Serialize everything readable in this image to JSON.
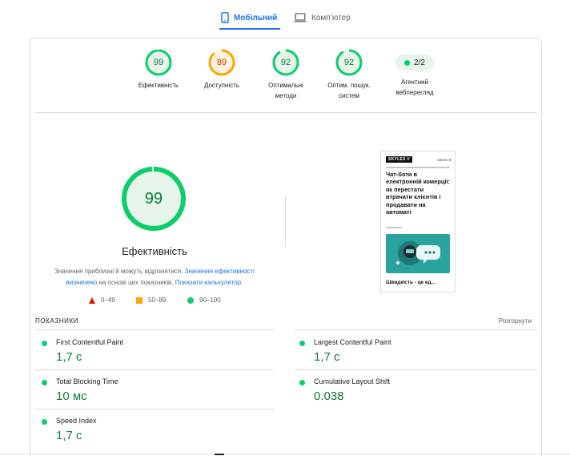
{
  "tabs": {
    "mobile": "Мобільний",
    "desktop": "Комп’ютер"
  },
  "gauges": [
    {
      "score": "99",
      "label": "Ефективність",
      "color": "#0cce6b",
      "fraction": 0.99
    },
    {
      "score": "89",
      "label": "Доступність",
      "color": "#ffa400",
      "fraction": 0.89
    },
    {
      "score": "92",
      "label_line1": "Оптимальні",
      "label_line2": "методи",
      "color": "#0cce6b",
      "fraction": 0.92
    },
    {
      "score": "92",
      "label_line1": "Оптим. пошук.",
      "label_line2": "систем",
      "color": "#0cce6b",
      "fraction": 0.92
    }
  ],
  "agent": {
    "value": "2/2",
    "label_line1": "Агентний",
    "label_line2": "вебперегляд"
  },
  "performance": {
    "score": "99",
    "fraction": 0.99,
    "title": "Ефективність",
    "desc_prefix": "Значення приблизні й можуть відрізнятися.",
    "desc_link1": "Значення ефективності визначено",
    "desc_middle": "на основі цих показників.",
    "desc_link2": "Показати калькулятор."
  },
  "legend": {
    "fail": "0–49",
    "average": "50–89",
    "pass": "90–100"
  },
  "thumbnail": {
    "logo": "SKYLEX //",
    "menu": "МЕНЮ",
    "heading": "Чат-боти в електронній комерції: як перестати втрачати клієнтів і продавати на автоматі",
    "footer": "Швидкість - це ед..."
  },
  "metrics": {
    "header": "ПОКАЗНИКИ",
    "expand": "Розгорнути",
    "items": [
      {
        "name": "First Contentful Paint",
        "value": "1,7 с"
      },
      {
        "name": "Largest Contentful Paint",
        "value": "1,7 с"
      },
      {
        "name": "Total Blocking Time",
        "value": "10 мс"
      },
      {
        "name": "Cumulative Layout Shift",
        "value": "0.038"
      },
      {
        "name": "Speed Index",
        "value": "1,7 с"
      }
    ]
  },
  "colors": {
    "pass": "#0cce6b",
    "average": "#ffa400",
    "fail": "#eb0f00",
    "accent": "#1a73e8"
  }
}
